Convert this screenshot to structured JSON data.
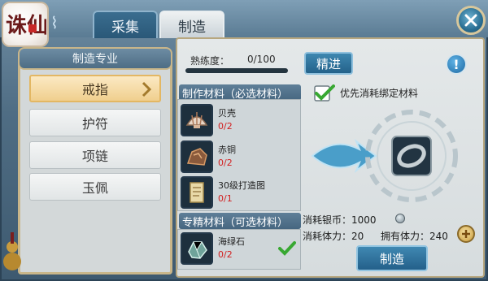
{
  "logo": {
    "text": "诛仙"
  },
  "tabs": {
    "collect": "采集",
    "make": "制造"
  },
  "left": {
    "header": "制造专业",
    "items": [
      "戒指",
      "护符",
      "项链",
      "玉佩"
    ],
    "selected_index": 0
  },
  "proficiency": {
    "label": "熟练度：",
    "value": "0/100",
    "progress": 0
  },
  "refine_button": "精进",
  "required_header": "制作材料（必选材料）",
  "materials": [
    {
      "name": "贝壳",
      "count": "0/2",
      "icon": "shell-icon"
    },
    {
      "name": "赤铜",
      "count": "0/2",
      "icon": "copper-ore-icon"
    },
    {
      "name": "30级打造图",
      "count": "0/1",
      "icon": "scroll-icon"
    }
  ],
  "optional_header": "专精材料（可选材料）",
  "optional_materials": [
    {
      "name": "海绿石",
      "count": "0/2",
      "icon": "green-stone-icon"
    }
  ],
  "priority_label": "优先消耗绑定材料",
  "cost": {
    "silver": "消耗银币：1000",
    "stamina": "消耗体力：20",
    "owned_stamina": "拥有体力：240"
  },
  "make_button": "制造",
  "colors": {
    "accent_blue": "#2a6f93",
    "required_count": "#d21e1e",
    "selected_item": "#f0cf8e"
  }
}
